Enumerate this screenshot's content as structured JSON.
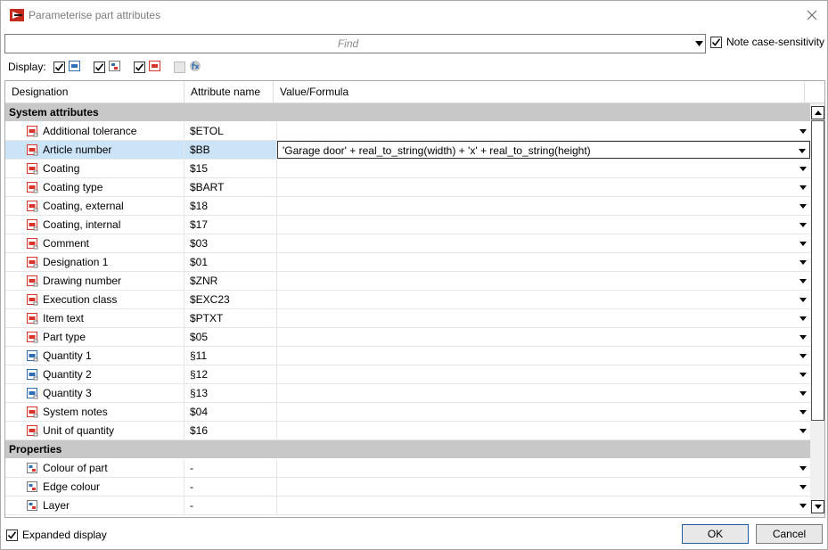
{
  "window": {
    "title": "Parameterise part attributes"
  },
  "find": {
    "placeholder": "Find",
    "note_case_label": "Note case-sensitivity",
    "note_case_checked": true
  },
  "display": {
    "label": "Display:",
    "filters": [
      {
        "icon": "number-attribute-icon",
        "checked": true,
        "enabled": true
      },
      {
        "icon": "list-attribute-icon",
        "checked": true,
        "enabled": true
      },
      {
        "icon": "text-attribute-icon",
        "checked": true,
        "enabled": true
      },
      {
        "icon": "formula-fx-icon",
        "checked": false,
        "enabled": false
      }
    ]
  },
  "grid": {
    "columns": [
      "Designation",
      "Attribute name",
      "Value/Formula"
    ],
    "groups": [
      {
        "title": "System attributes",
        "rows": [
          {
            "designation": "Additional tolerance",
            "attribute": "$ETOL",
            "value": "",
            "icon": "text-attribute-icon"
          },
          {
            "designation": "Article number",
            "attribute": "$BB",
            "value": "'Garage door' + real_to_string(width) + 'x' + real_to_string(height)",
            "icon": "text-attribute-icon",
            "selected": true
          },
          {
            "designation": "Coating",
            "attribute": "$15",
            "value": "",
            "icon": "text-attribute-icon"
          },
          {
            "designation": "Coating type",
            "attribute": "$BART",
            "value": "",
            "icon": "text-attribute-icon"
          },
          {
            "designation": "Coating, external",
            "attribute": "$18",
            "value": "",
            "icon": "text-attribute-icon"
          },
          {
            "designation": "Coating, internal",
            "attribute": "$17",
            "value": "",
            "icon": "text-attribute-icon"
          },
          {
            "designation": "Comment",
            "attribute": "$03",
            "value": "",
            "icon": "text-attribute-icon"
          },
          {
            "designation": "Designation 1",
            "attribute": "$01",
            "value": "",
            "icon": "text-attribute-icon"
          },
          {
            "designation": "Drawing number",
            "attribute": "$ZNR",
            "value": "",
            "icon": "text-attribute-icon"
          },
          {
            "designation": "Execution class",
            "attribute": "$EXC23",
            "value": "",
            "icon": "text-attribute-icon"
          },
          {
            "designation": "Item text",
            "attribute": "$PTXT",
            "value": "",
            "icon": "text-attribute-icon"
          },
          {
            "designation": "Part type",
            "attribute": "$05",
            "value": "",
            "icon": "text-attribute-icon"
          },
          {
            "designation": "Quantity 1",
            "attribute": "§11",
            "value": "",
            "icon": "number-attribute-icon"
          },
          {
            "designation": "Quantity 2",
            "attribute": "§12",
            "value": "",
            "icon": "number-attribute-icon"
          },
          {
            "designation": "Quantity 3",
            "attribute": "§13",
            "value": "",
            "icon": "number-attribute-icon"
          },
          {
            "designation": "System notes",
            "attribute": "$04",
            "value": "",
            "icon": "text-attribute-icon"
          },
          {
            "designation": "Unit of quantity",
            "attribute": "$16",
            "value": "",
            "icon": "text-attribute-icon"
          }
        ]
      },
      {
        "title": "Properties",
        "rows": [
          {
            "designation": "Colour of part",
            "attribute": "-",
            "value": "",
            "icon": "list-attribute-icon"
          },
          {
            "designation": "Edge colour",
            "attribute": "-",
            "value": "",
            "icon": "list-attribute-icon"
          },
          {
            "designation": "Layer",
            "attribute": "-",
            "value": "",
            "icon": "list-attribute-icon"
          }
        ]
      }
    ]
  },
  "footer": {
    "expanded_label": "Expanded display",
    "expanded_checked": true,
    "ok_label": "OK",
    "cancel_label": "Cancel"
  },
  "colors": {
    "group_bg": "#c8c8c8",
    "selected_bg": "#cce4f7",
    "icon_red": "#d9342b",
    "icon_blue": "#2f6db5"
  }
}
